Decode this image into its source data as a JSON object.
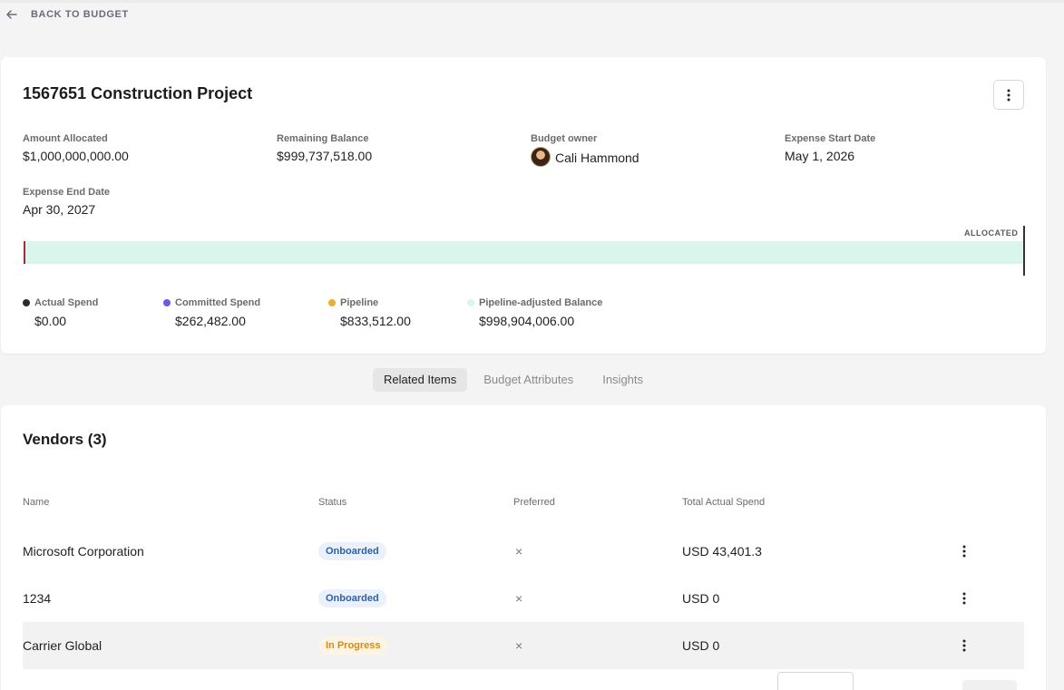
{
  "nav": {
    "back_label": "BACK TO BUDGET"
  },
  "project": {
    "title": "1567651 Construction Project",
    "fields": {
      "amount_allocated": {
        "label": "Amount Allocated",
        "value": "$1,000,000,000.00"
      },
      "remaining_balance": {
        "label": "Remaining Balance",
        "value": "$999,737,518.00"
      },
      "budget_owner": {
        "label": "Budget owner",
        "value": "Cali Hammond"
      },
      "expense_start": {
        "label": "Expense Start Date",
        "value": "May 1, 2026"
      },
      "expense_end": {
        "label": "Expense End Date",
        "value": "Apr 30, 2027"
      }
    },
    "bar": {
      "allocated_label": "ALLOCATED",
      "actual_fraction": 0.0
    },
    "legend": [
      {
        "label": "Actual Spend",
        "value": "$0.00",
        "color": "#2b2b2b"
      },
      {
        "label": "Committed Spend",
        "value": "$262,482.00",
        "color": "#6a5ae0"
      },
      {
        "label": "Pipeline",
        "value": "$833,512.00",
        "color": "#eeae2d"
      },
      {
        "label": "Pipeline-adjusted Balance",
        "value": "$998,904,006.00",
        "color": "#d9f5ec"
      }
    ]
  },
  "tabs": [
    "Related Items",
    "Budget Attributes",
    "Insights"
  ],
  "vendors": {
    "title": "Vendors (3)",
    "columns": [
      "Name",
      "Status",
      "Preferred",
      "Total Actual Spend"
    ],
    "rows": [
      {
        "name": "Microsoft Corporation",
        "status": "Onboarded",
        "preferred": "×",
        "spend": "USD 43,401.3"
      },
      {
        "name": "1234",
        "status": "Onboarded",
        "preferred": "×",
        "spend": "USD 0"
      },
      {
        "name": "Carrier Global",
        "status": "In Progress",
        "preferred": "×",
        "spend": "USD 0"
      }
    ]
  },
  "icons": {
    "back": "arrow-left-icon",
    "menu": "kebab-vertical-icon",
    "close": "x-icon"
  }
}
